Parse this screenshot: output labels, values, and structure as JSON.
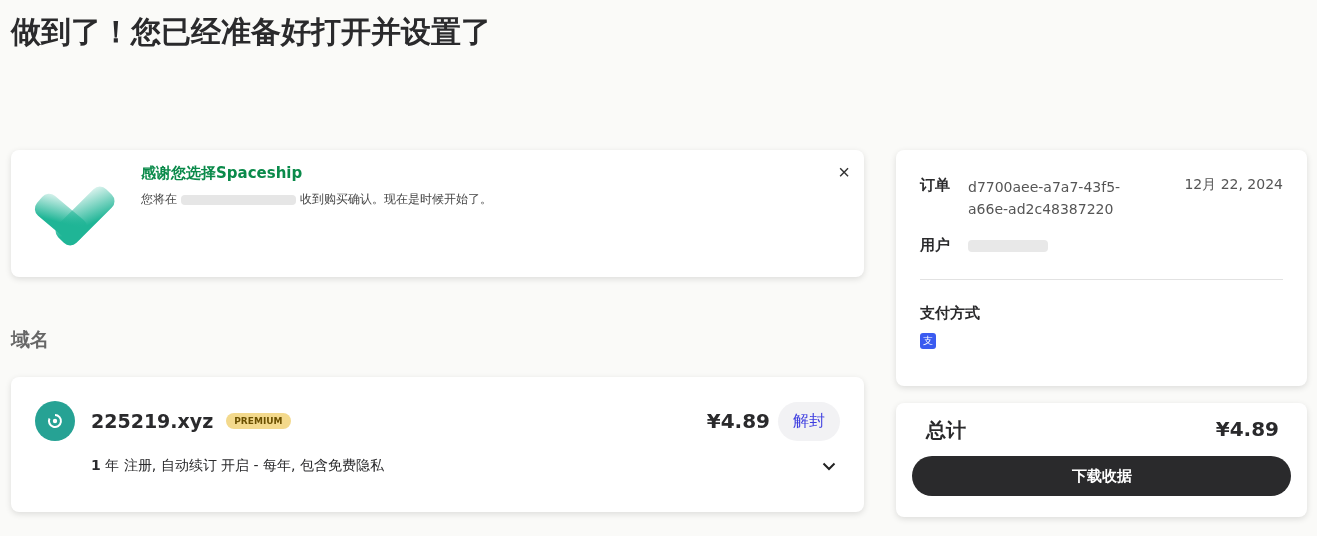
{
  "title": "做到了！您已经准备好打开并设置了",
  "notice": {
    "heading": "感谢您选择Spaceship",
    "message_before": "您将在",
    "message_after": "收到购买确认。现在是时候开始了。",
    "close": "×"
  },
  "section_title": "域名",
  "domain": {
    "name": "225219.xyz",
    "badge": "PREMIUM",
    "price": "¥4.89",
    "action": "解封",
    "details": "**1** 年 注册, 自动续订 开启 - 每年, 包含免费隐私",
    "expanded": false
  },
  "order": {
    "order_label": "订单",
    "order_id": "d7700aee-a7a7-43f5-a66e-ad2c48387220",
    "date": "12月 22, 2024",
    "user_label": "用户",
    "payment_label": "支付方式",
    "payment_icon": "支"
  },
  "total": {
    "label": "总计",
    "amount": "¥4.89",
    "button": "下载收据"
  }
}
